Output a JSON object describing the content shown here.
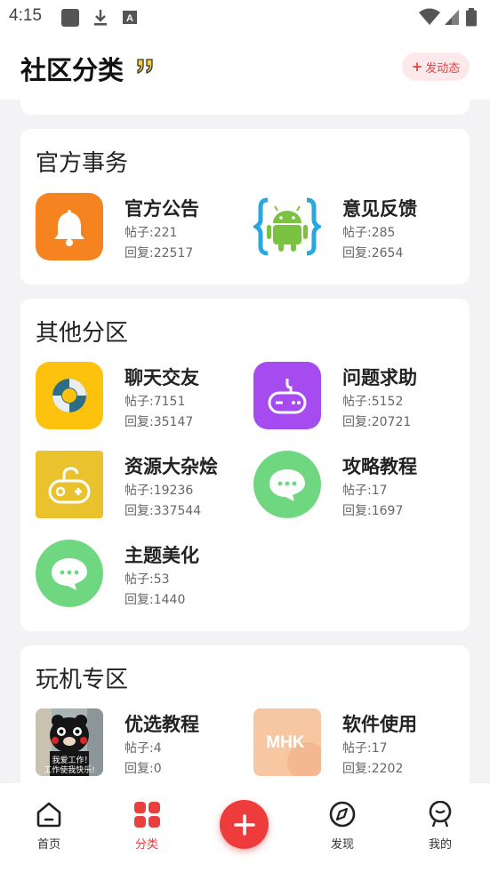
{
  "status_bar": {
    "time": "4:15",
    "icons": [
      "square-app-icon",
      "download-icon",
      "font-a-icon",
      "wifi-icon",
      "signal-icon",
      "battery-icon"
    ]
  },
  "header": {
    "title": "社区分类",
    "post_button_label": "发动态"
  },
  "sections": [
    {
      "title": "官方事务",
      "items": [
        {
          "name": "官方公告",
          "posts": "帖子:221",
          "replies": "回复:22517",
          "icon": "bell-icon",
          "color": "#f5831f"
        },
        {
          "name": "意见反馈",
          "posts": "帖子:285",
          "replies": "回复:2654",
          "icon": "android-icon",
          "color": "#3ddc84"
        }
      ]
    },
    {
      "title": "其他分区",
      "items": [
        {
          "name": "聊天交友",
          "posts": "帖子:7151",
          "replies": "回复:35147",
          "icon": "lifebuoy-icon",
          "color": "#fdc20d"
        },
        {
          "name": "问题求助",
          "posts": "帖子:5152",
          "replies": "回复:20721",
          "icon": "gamepad-icon",
          "color": "#a64bf0"
        },
        {
          "name": "资源大杂烩",
          "posts": "帖子:19236",
          "replies": "回复:337544",
          "icon": "joystick-icon",
          "color": "#e9c22e"
        },
        {
          "name": "攻略教程",
          "posts": "帖子:17",
          "replies": "回复:1697",
          "icon": "chat-bubble-icon",
          "color": "#6fd77f"
        },
        {
          "name": "主题美化",
          "posts": "帖子:53",
          "replies": "回复:1440",
          "icon": "chat-bubble-icon",
          "color": "#6fd77f"
        }
      ]
    },
    {
      "title": "玩机专区",
      "items": [
        {
          "name": "优选教程",
          "posts": "帖子:4",
          "replies": "回复:0",
          "icon": "bear-photo-icon",
          "caption_top": "我爱工作！",
          "caption_bottom": "工作使我快乐!"
        },
        {
          "name": "软件使用",
          "posts": "帖子:17",
          "replies": "回复:2202",
          "icon": "mhk-logo-icon",
          "logo_text": "MHK",
          "color": "#f7c8a0"
        }
      ]
    }
  ],
  "bottom_nav": {
    "items": [
      {
        "label": "首页",
        "icon": "home-icon"
      },
      {
        "label": "分类",
        "icon": "category-grid-icon",
        "active": true
      },
      {
        "label": "发现",
        "icon": "compass-icon"
      },
      {
        "label": "我的",
        "icon": "profile-face-icon"
      }
    ],
    "center_icon": "add-icon"
  },
  "colors": {
    "accent": "#e8403f",
    "background": "#f3f3f5",
    "card": "#ffffff"
  }
}
